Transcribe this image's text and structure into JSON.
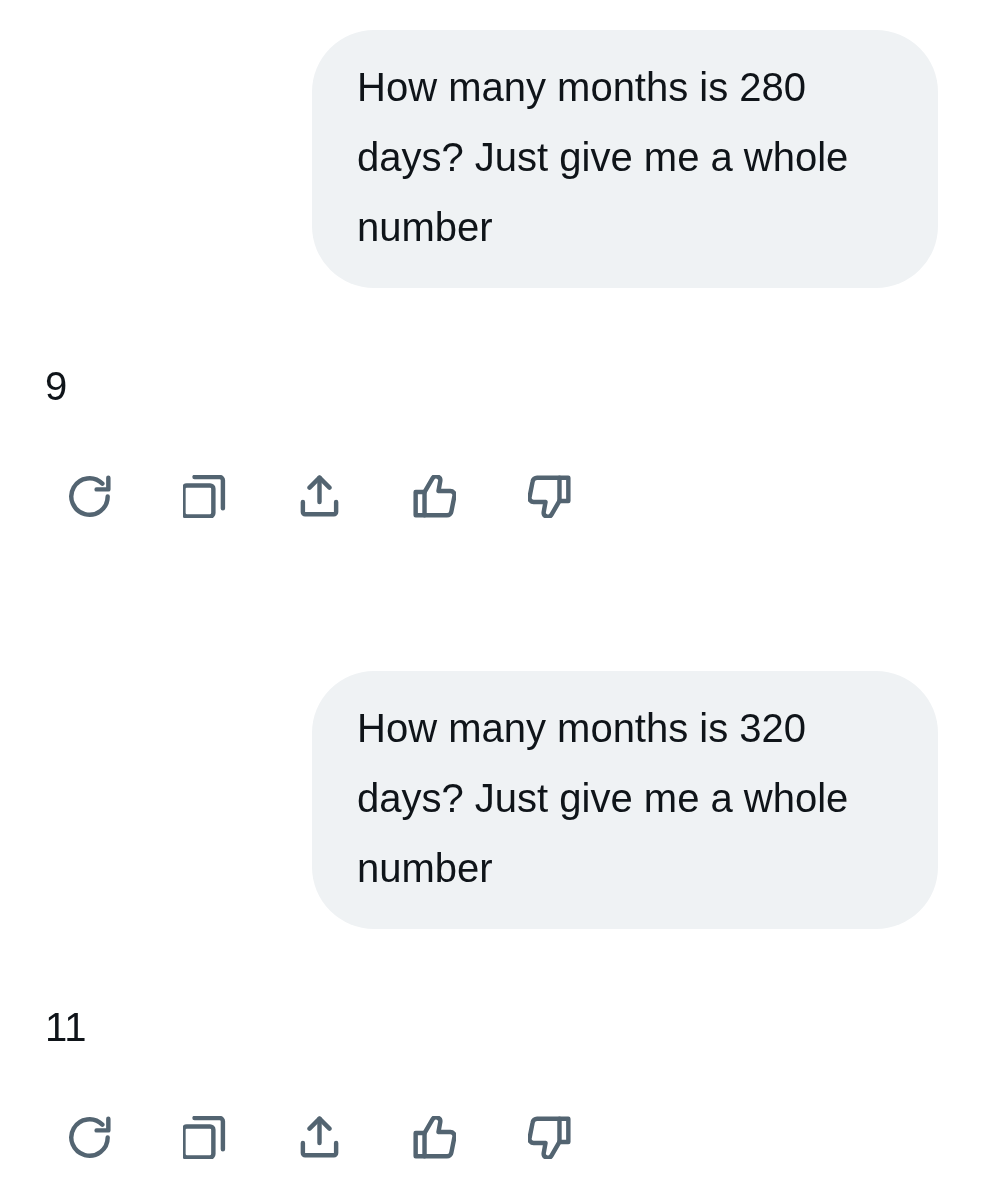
{
  "conversation": [
    {
      "kind": "user",
      "text": "How many months is 280 days? Just give me a whole number"
    },
    {
      "kind": "assistant",
      "text": "9"
    },
    {
      "kind": "user",
      "text": "How many months is 320 days? Just give me a whole number"
    },
    {
      "kind": "assistant",
      "text": "11"
    }
  ]
}
